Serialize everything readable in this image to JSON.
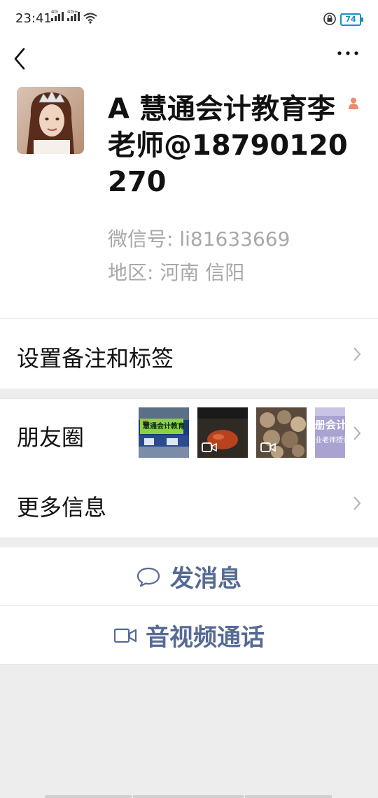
{
  "status_bar": {
    "time": "23:41",
    "signal1_tag": "4G",
    "signal2_tag": "4G+",
    "battery": "74"
  },
  "profile": {
    "name": "A 慧通会计教育李老师@18790120270",
    "wechat_id": "微信号:  li81633669",
    "region": "地区:  河南  信阳"
  },
  "rows": {
    "remark_label": "设置备注和标签",
    "moments_label": "朋友圈",
    "more_info_label": "更多信息"
  },
  "moments": {
    "thumb1_text": "慧通会计教育",
    "thumb4_line1": "册会计",
    "thumb4_line2": "业老师授课"
  },
  "actions": {
    "message_label": "发消息",
    "video_call_label": "音视频通话"
  },
  "colors": {
    "link_blue": "#566a94",
    "battery_blue": "#1a8fc6",
    "secondary_gray": "#a8a8a8"
  }
}
